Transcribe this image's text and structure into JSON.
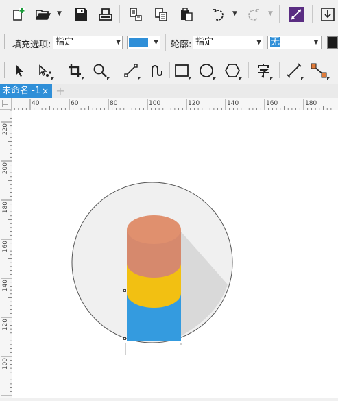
{
  "property_bar": {
    "fill_label": "填充选项:",
    "fill_mode": "指定",
    "fill_color": "#2f8fd8",
    "outline_label": "轮廓:",
    "outline_mode": "指定",
    "outline_width": "无"
  },
  "document_tab": {
    "title": "未命名 -1",
    "close_glyph": "×",
    "add_glyph": "+"
  },
  "ruler": {
    "horizontal_ticks": [
      "40",
      "60",
      "80",
      "100",
      "120",
      "140",
      "160",
      "180"
    ],
    "vertical_ticks": [
      "220",
      "200",
      "180",
      "160",
      "140",
      "120",
      "100"
    ]
  },
  "drawing": {
    "circle_color": "#f0f0f0",
    "shadow_color": "#d9d9d9",
    "band_colors": [
      "#e0906e",
      "#f2c012",
      "#349bdf"
    ]
  },
  "icons": {
    "standard_toolbar": [
      "new-document-icon",
      "open-folder-icon",
      "save-icon",
      "print-icon",
      "import-icon",
      "export-icon",
      "paste-icon",
      "undo-icon",
      "redo-icon",
      "snap-toggle-icon",
      "download-icon"
    ],
    "toolbox": [
      "pick-tool-icon",
      "shape-tool-icon",
      "crop-tool-icon",
      "zoom-tool-icon",
      "freehand-tool-icon",
      "artistic-media-icon",
      "rectangle-tool-icon",
      "ellipse-tool-icon",
      "polygon-tool-icon",
      "text-tool-icon",
      "dimension-tool-icon",
      "connector-tool-icon"
    ]
  }
}
